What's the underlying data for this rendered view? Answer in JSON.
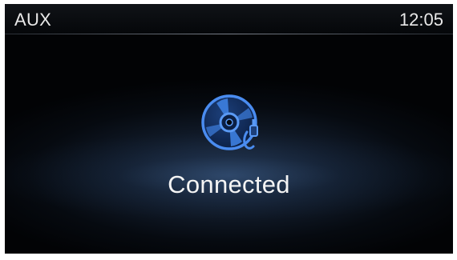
{
  "header": {
    "source_label": "AUX",
    "clock": "12:05"
  },
  "main": {
    "icon": "disc-with-aux-plug-icon",
    "status": "Connected"
  },
  "colors": {
    "icon_blue": "#3d7fe0",
    "background": "#05080d",
    "text": "#f4f4f4"
  }
}
